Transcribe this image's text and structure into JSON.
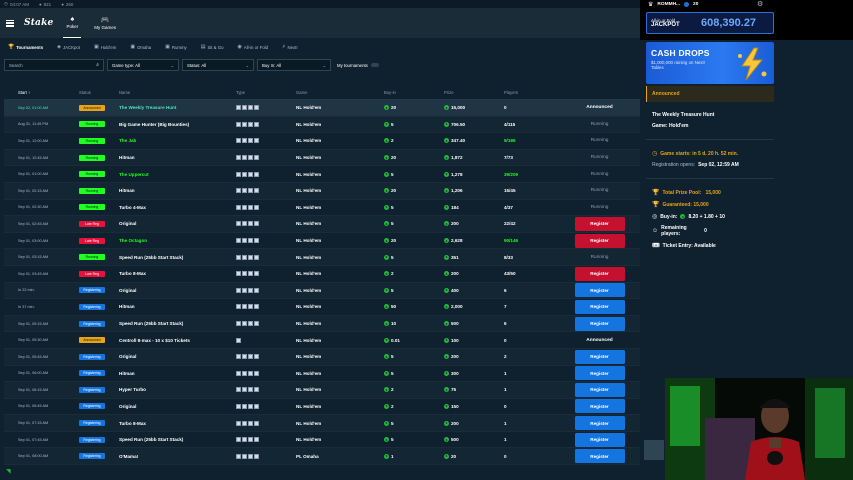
{
  "os_bar": {
    "time": "04:07 AM",
    "stat1": "821",
    "stat2": "260"
  },
  "header": {
    "logo": "Stake",
    "tabs": [
      {
        "label": "Poker",
        "icon": "poker-icon"
      },
      {
        "label": "My Games",
        "icon": "my-games-icon"
      }
    ]
  },
  "subnav": [
    {
      "label": "Tournaments",
      "active": true
    },
    {
      "label": "JACKpot"
    },
    {
      "label": "Hold'em"
    },
    {
      "label": "Omaha"
    },
    {
      "label": "Rummy"
    },
    {
      "label": "Sit & Go"
    },
    {
      "label": "All-in or Fold"
    },
    {
      "label": "Next!"
    }
  ],
  "filters": {
    "search_placeholder": "Search",
    "game_type": "Game type: All",
    "status": "Status: All",
    "buy_in": "Buy In: All",
    "my_tournaments": "My tournaments"
  },
  "table": {
    "headers": {
      "start": "Start ↑",
      "status": "Status",
      "name": "Name",
      "type": "Type",
      "game": "Game",
      "buyin": "Buy-in",
      "prize": "Prize",
      "players": "Players"
    },
    "rows": [
      {
        "start": "Sep 02, 01:00 AM",
        "status": "Announced",
        "status_kind": "announced",
        "name": "The Weekly Treasure Hunt",
        "name_color": "teal",
        "types": 4,
        "game": "NL Hold'em",
        "buyin": "20",
        "prize": "15,000",
        "players": "0",
        "action": "Announced",
        "action_kind": "text-bright",
        "highlight": true
      },
      {
        "start": "Aug 31, 11:45 PM",
        "status": "Running",
        "status_kind": "running",
        "name": "Big Game Hunter (Big Bounties)",
        "types": 4,
        "game": "NL Hold'em",
        "buyin": "5",
        "prize": "706.50",
        "players": "4/115",
        "action": "Running",
        "action_kind": "text"
      },
      {
        "start": "Sep 01, 12:00 AM",
        "status": "Running",
        "status_kind": "running",
        "name": "The Jab",
        "name_color": "green",
        "types": 4,
        "game": "NL Hold'em",
        "buyin": "2",
        "prize": "347.40",
        "players": "9/186",
        "players_color": "green",
        "action": "Running",
        "action_kind": "text"
      },
      {
        "start": "Sep 01, 12:45 AM",
        "status": "Running",
        "status_kind": "running",
        "name": "Hitman",
        "types": 4,
        "game": "NL Hold'em",
        "buyin": "20",
        "prize": "1,872",
        "players": "7/73",
        "action": "Running",
        "action_kind": "text"
      },
      {
        "start": "Sep 01, 01:00 AM",
        "status": "Running",
        "status_kind": "running",
        "name": "The Uppercut",
        "name_color": "green",
        "types": 4,
        "game": "NL Hold'em",
        "buyin": "5",
        "prize": "1,278",
        "players": "39/209",
        "players_color": "green",
        "action": "Running",
        "action_kind": "text"
      },
      {
        "start": "Sep 01, 02:15 AM",
        "status": "Running",
        "status_kind": "running",
        "name": "Hitman",
        "types": 4,
        "game": "NL Hold'em",
        "buyin": "20",
        "prize": "1,206",
        "players": "15/45",
        "action": "Running",
        "action_kind": "text"
      },
      {
        "start": "Sep 01, 02:30 AM",
        "status": "Running",
        "status_kind": "running",
        "name": "Turbo 4-Max",
        "types": 4,
        "game": "NL Hold'em",
        "buyin": "5",
        "prize": "184",
        "players": "4/37",
        "action": "Running",
        "action_kind": "text"
      },
      {
        "start": "Sep 01, 02:45 AM",
        "status": "Late Reg",
        "status_kind": "late",
        "name": "Original",
        "types": 4,
        "game": "NL Hold'em",
        "buyin": "5",
        "prize": "200",
        "players": "22/42",
        "action": "Register",
        "action_kind": "red"
      },
      {
        "start": "Sep 01, 03:00 AM",
        "status": "Late Reg",
        "status_kind": "late",
        "name": "The Octagon",
        "name_color": "green",
        "types": 4,
        "game": "NL Hold'em",
        "buyin": "20",
        "prize": "2,628",
        "players": "90/146",
        "players_color": "green",
        "action": "Register",
        "action_kind": "red"
      },
      {
        "start": "Sep 01, 03:15 AM",
        "status": "Running",
        "status_kind": "running",
        "name": "Speed Run (25bb Start Stack)",
        "types": 4,
        "game": "NL Hold'em",
        "buyin": "5",
        "prize": "351",
        "players": "8/33",
        "action": "Running",
        "action_kind": "text"
      },
      {
        "start": "Sep 01, 03:45 AM",
        "status": "Late Reg",
        "status_kind": "late",
        "name": "Turbo 8-Max",
        "types": 4,
        "game": "NL Hold'em",
        "buyin": "2",
        "prize": "200",
        "players": "43/50",
        "action": "Register",
        "action_kind": "red"
      },
      {
        "start": "In 22 min.",
        "status": "Registering",
        "status_kind": "registering",
        "name": "Original",
        "types": 4,
        "game": "NL Hold'em",
        "buyin": "5",
        "prize": "400",
        "players": "6",
        "action": "Register",
        "action_kind": "blue"
      },
      {
        "start": "In 37 min.",
        "status": "Registering",
        "status_kind": "registering",
        "name": "Hitman",
        "types": 4,
        "game": "NL Hold'em",
        "buyin": "50",
        "prize": "2,000",
        "players": "7",
        "action": "Register",
        "action_kind": "blue"
      },
      {
        "start": "Sep 01, 05:15 AM",
        "status": "Registering",
        "status_kind": "registering",
        "name": "Speed Run (25bb Start Stack)",
        "types": 4,
        "game": "NL Hold'em",
        "buyin": "10",
        "prize": "500",
        "players": "6",
        "action": "Register",
        "action_kind": "blue"
      },
      {
        "start": "Sep 01, 05:30 AM",
        "status": "Announced",
        "status_kind": "announced",
        "name": "Centroll 8-max - 10 x $10 Tickets",
        "types": 1,
        "game": "NL Hold'em",
        "buyin": "0.01",
        "prize": "100",
        "players": "0",
        "action": "Announced",
        "action_kind": "text-bright"
      },
      {
        "start": "Sep 01, 05:45 AM",
        "status": "Registering",
        "status_kind": "registering",
        "name": "Original",
        "types": 4,
        "game": "NL Hold'em",
        "buyin": "5",
        "prize": "200",
        "players": "2",
        "action": "Register",
        "action_kind": "blue"
      },
      {
        "start": "Sep 01, 06:00 AM",
        "status": "Registering",
        "status_kind": "registering",
        "name": "Hitman",
        "types": 4,
        "game": "NL Hold'em",
        "buyin": "5",
        "prize": "300",
        "players": "1",
        "action": "Register",
        "action_kind": "blue"
      },
      {
        "start": "Sep 01, 06:15 AM",
        "status": "Registering",
        "status_kind": "registering",
        "name": "Hyper Turbo",
        "types": 4,
        "game": "NL Hold'em",
        "buyin": "2",
        "prize": "75",
        "players": "1",
        "action": "Register",
        "action_kind": "blue"
      },
      {
        "start": "Sep 01, 06:45 AM",
        "status": "Registering",
        "status_kind": "registering",
        "name": "Original",
        "types": 4,
        "game": "NL Hold'em",
        "buyin": "2",
        "prize": "150",
        "players": "0",
        "action": "Register",
        "action_kind": "blue"
      },
      {
        "start": "Sep 01, 07:15 AM",
        "status": "Registering",
        "status_kind": "registering",
        "name": "Turbo 8-Max",
        "types": 4,
        "game": "NL Hold'em",
        "buyin": "5",
        "prize": "200",
        "players": "1",
        "action": "Register",
        "action_kind": "blue"
      },
      {
        "start": "Sep 01, 07:45 AM",
        "status": "Registering",
        "status_kind": "registering",
        "name": "Speed Run (25bb Start Stack)",
        "types": 4,
        "game": "NL Hold'em",
        "buyin": "5",
        "prize": "500",
        "players": "1",
        "action": "Register",
        "action_kind": "blue"
      },
      {
        "start": "Sep 01, 08:00 AM",
        "status": "Registering",
        "status_kind": "registering",
        "name": "O'Mama!",
        "types": 4,
        "game": "PL Omaha",
        "buyin": "1",
        "prize": "20",
        "players": "0",
        "action": "Register",
        "action_kind": "blue"
      }
    ]
  },
  "account": {
    "username": "ROMMH...",
    "level": "20"
  },
  "jackpot": {
    "label_line1": "All-in or Fold",
    "label_line2": "JACKPOT",
    "amount": "608,390.27"
  },
  "promo": {
    "title": "CASH DROPS",
    "subtitle": "$1,000,000 raining on Next! Tables"
  },
  "details": {
    "status": "Announced",
    "name": "The Weekly Treasure Hunt",
    "game": "Game: Hold'em",
    "starts": "Game starts: in 5 d. 20 h. 52 min.",
    "reg_opens_label": "Registration opens:",
    "reg_opens_value": "Sep 02, 12:59 AM",
    "total_prize_label": "Total Prize Pool:",
    "total_prize_value": "15,000",
    "guaranteed": "Guaranteed: 15,000",
    "buyin_label": "Buy-in:",
    "buyin_value": "8.20 + 1.80 + 10",
    "remaining_label": "Remaining players:",
    "remaining_value": "0",
    "ticket": "Ticket Entry: Available"
  },
  "colors": {
    "bg": "#0f212e",
    "topbar": "#1a2c38",
    "running": "#1fff20",
    "announced": "#e8a317",
    "late": "#e9113c",
    "registering": "#1475e1",
    "coin": "#1fba3a",
    "jackpot": "#67a8ff"
  }
}
